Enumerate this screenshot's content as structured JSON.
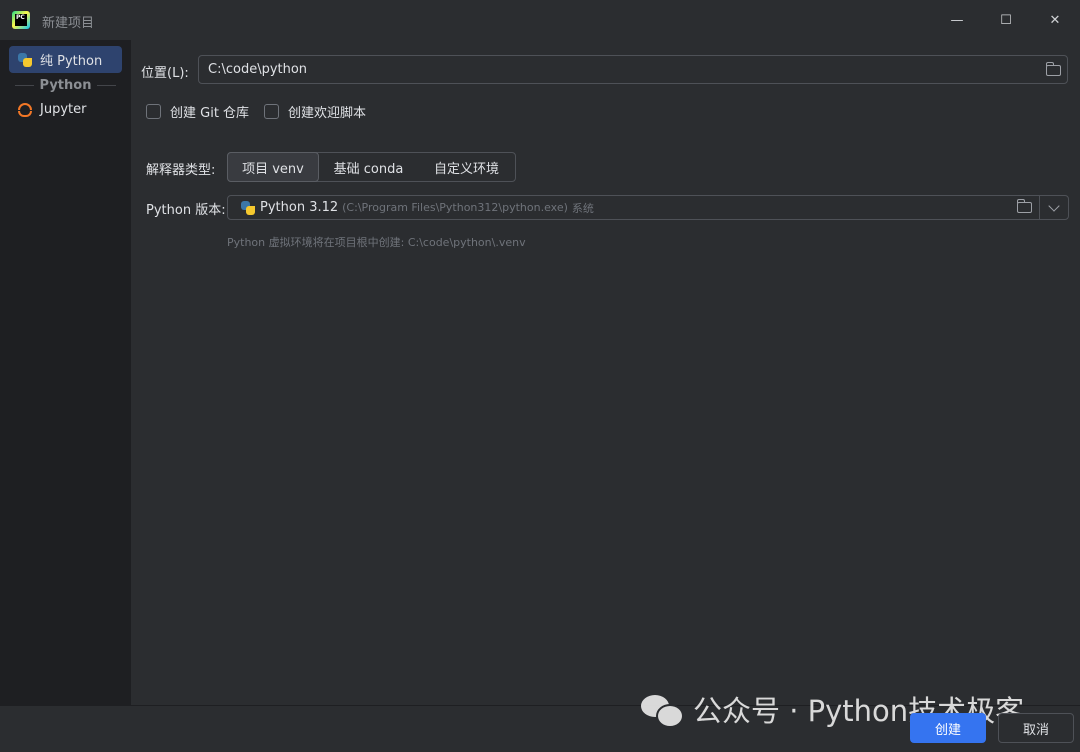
{
  "window": {
    "title": "新建项目",
    "app_icon_label": "PC",
    "minimize_glyph": "—",
    "maximize_glyph": "☐",
    "close_glyph": "✕"
  },
  "sidebar": {
    "items": [
      {
        "label": "纯 Python",
        "icon": "python-icon",
        "selected": true
      },
      {
        "label": "Jupyter",
        "icon": "jupyter-icon",
        "selected": false
      }
    ],
    "section_header": "Python"
  },
  "form": {
    "location_label": "位置(L):",
    "location_value": "C:\\code\\python",
    "git_checkbox_label": "创建 Git 仓库",
    "welcome_checkbox_label": "创建欢迎脚本",
    "interpreter_type_label": "解释器类型:",
    "interpreter_types": [
      {
        "label": "项目 venv",
        "active": true
      },
      {
        "label": "基础 conda",
        "active": false
      },
      {
        "label": "自定义环境",
        "active": false
      }
    ],
    "python_version_label": "Python 版本:",
    "python_version_value": "Python 3.12",
    "python_version_path": "(C:\\Program Files\\Python312\\python.exe)",
    "python_version_suffix": "系统",
    "hint": "Python 虚拟环境将在项目根中创建: C:\\code\\python\\.venv"
  },
  "footer": {
    "create_label": "创建",
    "cancel_label": "取消"
  },
  "watermark": {
    "text": "公众号 · Python技术极客"
  },
  "colors": {
    "accent": "#3574f0",
    "selection": "#2e436e",
    "background": "#2b2d30",
    "sidebar_bg": "#1e1f22"
  }
}
